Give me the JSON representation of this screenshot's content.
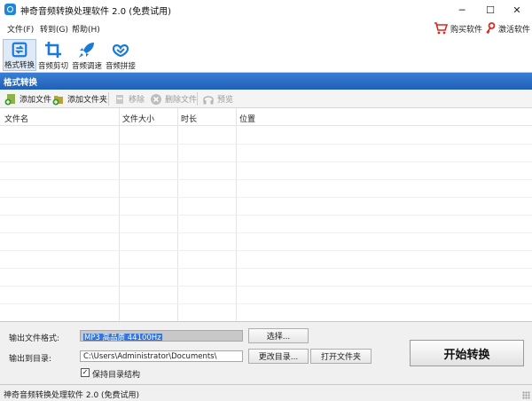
{
  "window": {
    "title": "神奇音频转换处理软件 2.0 (免费试用)",
    "icon": "app-logo-icon",
    "controls": {
      "minimize": "─",
      "maximize": "☐",
      "close": "✕"
    }
  },
  "menu": {
    "items": [
      "文件(F)",
      "转到(G)",
      "帮助(H)"
    ],
    "buy_label": "购买软件",
    "activate_label": "激活软件"
  },
  "toolbar": {
    "tools": [
      {
        "label": "格式转换",
        "icon": "convert-icon",
        "active": true
      },
      {
        "label": "音频剪切",
        "icon": "crop-icon",
        "active": false
      },
      {
        "label": "音频调速",
        "icon": "rocket-icon",
        "active": false
      },
      {
        "label": "音频拼接",
        "icon": "join-icon",
        "active": false
      }
    ]
  },
  "section": {
    "title": "格式转换"
  },
  "actions": {
    "add_file": "添加文件",
    "add_folder": "添加文件夹",
    "remove": "移除",
    "delete_file": "删除文件",
    "preview": "预览"
  },
  "table": {
    "columns": [
      "文件名",
      "文件大小",
      "时长",
      "位置"
    ],
    "rows": []
  },
  "output": {
    "format_label": "输出文件格式:",
    "format_value": "MP3 高品质 44100Hz",
    "choose_button": "选择...",
    "dir_label": "输出到目录:",
    "dir_value": "C:\\Users\\Administrator\\Documents\\",
    "change_dir_button": "更改目录...",
    "open_folder_button": "打开文件夹",
    "keep_structure_label": "保持目录结构",
    "keep_structure_checked": true,
    "start_button": "开始转换"
  },
  "status": {
    "text": "神奇音频转换处理软件 2.0 (免费试用)"
  },
  "colors": {
    "accent": "#1f5fb8",
    "header_gradient_top": "#3a7fd5",
    "selection": "#3875d7"
  }
}
